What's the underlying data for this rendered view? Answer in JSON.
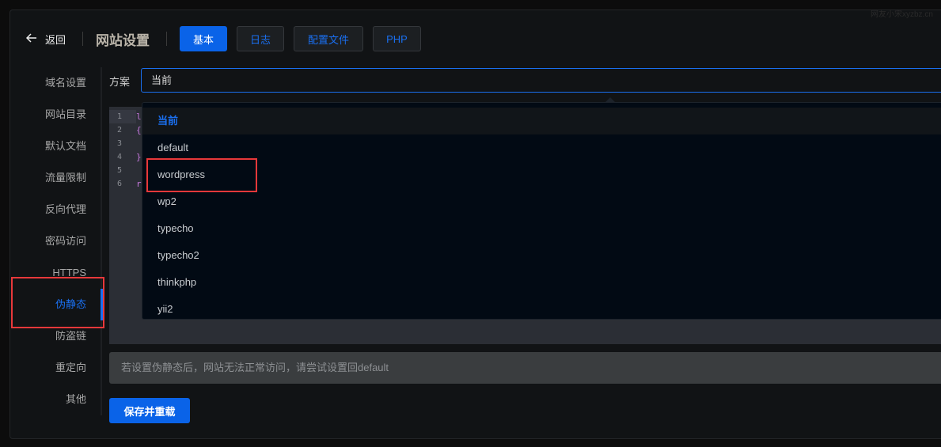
{
  "watermark": "网友小宋xyzbz.cn",
  "header": {
    "back_label": "返回",
    "title": "网站设置",
    "tabs": [
      {
        "label": "基本",
        "active": true
      },
      {
        "label": "日志"
      },
      {
        "label": "配置文件"
      },
      {
        "label": "PHP"
      }
    ]
  },
  "sidebar": {
    "items": [
      "域名设置",
      "网站目录",
      "默认文档",
      "流量限制",
      "反向代理",
      "密码访问",
      "HTTPS",
      "伪静态",
      "防盗链",
      "重定向",
      "其他"
    ],
    "active": "伪静态"
  },
  "form": {
    "label": "方案",
    "selected": "当前"
  },
  "dropdown": {
    "options": [
      "当前",
      "default",
      "wordpress",
      "wp2",
      "typecho",
      "typecho2",
      "thinkphp",
      "yii2"
    ],
    "highlighted": "wordpress"
  },
  "editor": {
    "line_numbers": [
      "1",
      "2",
      "3",
      "4",
      "5",
      "6"
    ],
    "visible_code": [
      "l",
      "{",
      "",
      "}",
      "",
      "r"
    ]
  },
  "notice": "若设置伪静态后，网站无法正常访问，请尝试设置回default",
  "save_label": "保存并重载",
  "colors": {
    "accent": "#0a63e8",
    "highlight_box": "#e8383a"
  }
}
